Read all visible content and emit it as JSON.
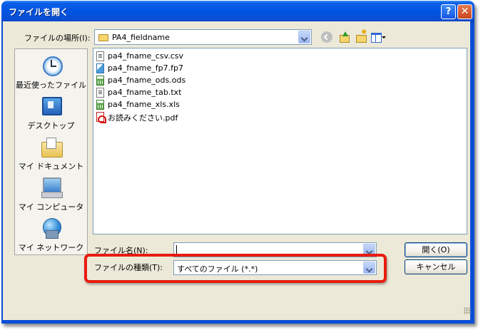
{
  "window": {
    "title": "ファイルを開く",
    "help_glyph": "?",
    "close_glyph": "✕"
  },
  "lookin": {
    "label": "ファイルの場所(I):",
    "value": "PA4_fieldname"
  },
  "places": [
    {
      "label": "最近使ったファイル",
      "icon": "recent-files-icon"
    },
    {
      "label": "デスクトップ",
      "icon": "desktop-icon"
    },
    {
      "label": "マイ ドキュメント",
      "icon": "my-documents-icon"
    },
    {
      "label": "マイ コンピュータ",
      "icon": "my-computer-icon"
    },
    {
      "label": "マイ ネットワーク",
      "icon": "my-network-icon"
    }
  ],
  "files": [
    {
      "name": "pa4_fname_csv.csv",
      "icon": "text-file-icon"
    },
    {
      "name": "pa4_fname_fp7.fp7",
      "icon": "filemaker-file-icon"
    },
    {
      "name": "pa4_fname_ods.ods",
      "icon": "spreadsheet-file-icon"
    },
    {
      "name": "pa4_fname_tab.txt",
      "icon": "text-file-icon"
    },
    {
      "name": "pa4_fname_xls.xls",
      "icon": "spreadsheet-file-icon"
    },
    {
      "name": "お読みください.pdf",
      "icon": "pdf-file-icon"
    }
  ],
  "filename": {
    "label": "ファイル名(N):",
    "value": ""
  },
  "filetype": {
    "label": "ファイルの種類(T):",
    "value": "すべてのファイル (*.*)"
  },
  "buttons": {
    "open": "開く(O)",
    "cancel": "キャンセル"
  },
  "colors": {
    "highlight": "#e81c10",
    "titlebar": "#0054e3",
    "dialog_bg": "#ece9d8"
  }
}
